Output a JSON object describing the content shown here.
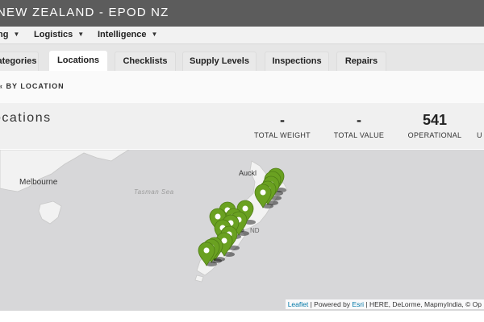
{
  "app": {
    "title": "NEW ZEALAND - EPOD NZ"
  },
  "menu": {
    "items": [
      {
        "label": "ng",
        "caret": "chevron-down-icon"
      },
      {
        "label": "Logistics",
        "caret": "chevron-down-icon"
      },
      {
        "label": "Intelligence",
        "caret": "chevron-down-icon"
      }
    ]
  },
  "tabs": [
    {
      "label": "ategories",
      "active": false
    },
    {
      "label": "Locations",
      "active": true
    },
    {
      "label": "Checklists",
      "active": false
    },
    {
      "label": "Supply Levels",
      "active": false
    },
    {
      "label": "Inspections",
      "active": false
    },
    {
      "label": "Repairs",
      "active": false
    }
  ],
  "breadcrumb": {
    "text": "« BY LOCATION"
  },
  "header": {
    "title": "ocations",
    "stats": [
      {
        "value": "-",
        "label": "TOTAL WEIGHT"
      },
      {
        "value": "-",
        "label": "TOTAL VALUE"
      },
      {
        "value": "541",
        "label": "OPERATIONAL"
      },
      {
        "value": "",
        "label": "U"
      }
    ]
  },
  "map": {
    "labels": {
      "melbourne": "Melbourne",
      "tasman_sea": "Tasman Sea",
      "auckland": "Auckl",
      "nz_partial": "ND"
    },
    "marker_color": "#6aa121",
    "marker_icon": "map-marker-icon",
    "attribution": {
      "leaflet": "Leaflet",
      "sep1": " | Powered by ",
      "esri": "Esri",
      "rest": " | HERE, DeLorme, MapmyIndia, © Op"
    }
  },
  "colors": {
    "topbar": "#5c5c5c",
    "link": "#0078a8",
    "marker": "#6aa121"
  }
}
